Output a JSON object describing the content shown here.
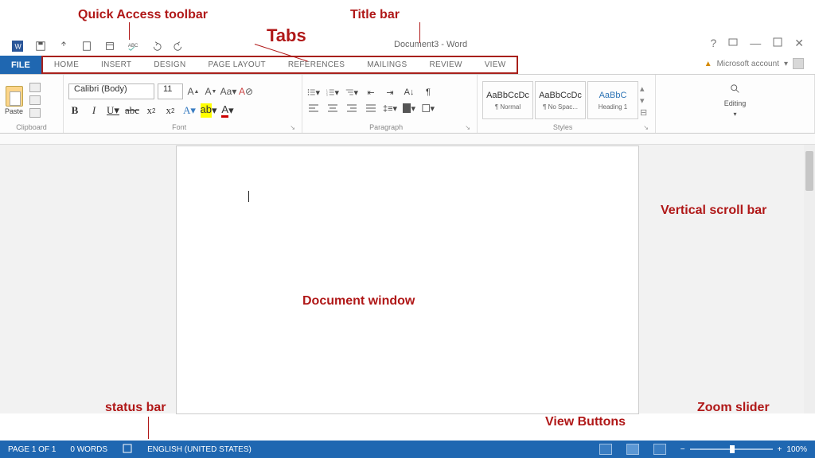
{
  "annotations": {
    "qat": "Quick Access toolbar",
    "tabs": "Tabs",
    "title_bar": "Title bar",
    "vscroll": "Vertical scroll bar",
    "doc_window": "Document window",
    "status": "status bar",
    "view_buttons": "View Buttons",
    "zoom_slider": "Zoom slider"
  },
  "title": "Document3 - Word",
  "tabs": {
    "file": "FILE",
    "home": "HOME",
    "insert": "INSERT",
    "design": "DESIGN",
    "page_layout": "PAGE LAYOUT",
    "references": "REFERENCES",
    "mailings": "MAILINGS",
    "review": "REVIEW",
    "view": "VIEW"
  },
  "account": {
    "label": "Microsoft account"
  },
  "ribbon": {
    "clipboard": {
      "paste": "Paste",
      "label": "Clipboard"
    },
    "font": {
      "name": "Calibri (Body)",
      "size": "11",
      "label": "Font"
    },
    "paragraph": {
      "label": "Paragraph"
    },
    "styles": {
      "label": "Styles",
      "items": [
        {
          "sample": "AaBbCcDc",
          "name": "¶ Normal"
        },
        {
          "sample": "AaBbCcDc",
          "name": "¶ No Spac..."
        },
        {
          "sample": "AaBbC",
          "name": "Heading 1"
        }
      ]
    },
    "editing": {
      "label": "Editing"
    }
  },
  "status": {
    "page": "PAGE 1 OF 1",
    "words": "0 WORDS",
    "language": "ENGLISH (UNITED STATES)",
    "zoom": "100%"
  }
}
